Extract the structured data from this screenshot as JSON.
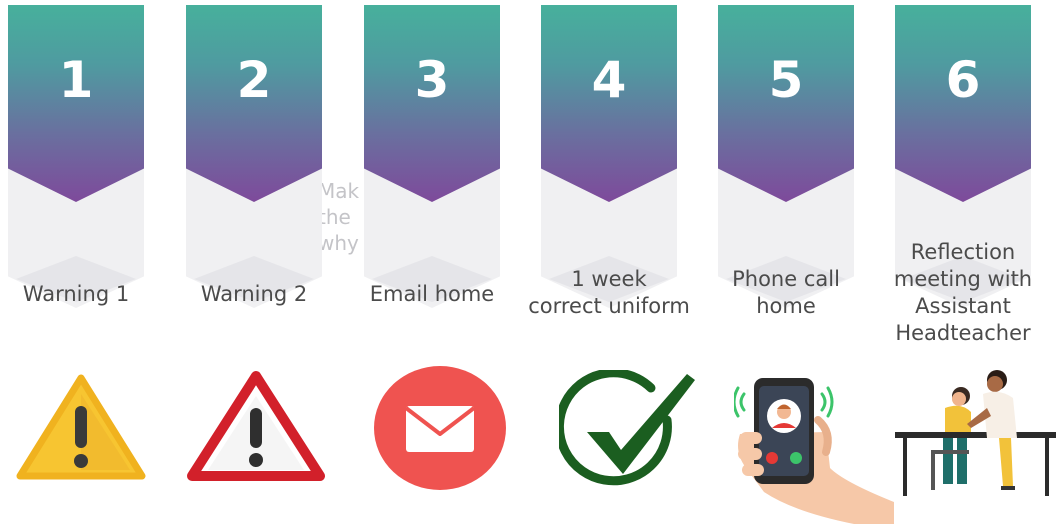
{
  "steps": [
    {
      "number": "1",
      "label_lines": [
        "Warning 1"
      ],
      "icon": "warning-triangle-yellow-icon",
      "color": "#f7c531"
    },
    {
      "number": "2",
      "label_lines": [
        "Warning 2"
      ],
      "icon": "warning-triangle-red-icon",
      "color": "#d2202a"
    },
    {
      "number": "3",
      "label_lines": [
        "Email home"
      ],
      "icon": "envelope-icon",
      "color": "#ef5350"
    },
    {
      "number": "4",
      "label_lines": [
        "1 week",
        "correct uniform"
      ],
      "icon": "checkmark-icon",
      "color": "#1b5e20"
    },
    {
      "number": "5",
      "label_lines": [
        "Phone call",
        "home"
      ],
      "icon": "phone-call-icon",
      "color": "#2b2b2b"
    },
    {
      "number": "6",
      "label_lines": [
        "Reflection",
        "meeting with",
        "Assistant",
        "Headteacher"
      ],
      "icon": "meeting-icon",
      "color": "#f2c23a"
    }
  ],
  "faded_text": [
    "Mak",
    "the",
    "why"
  ],
  "colors": {
    "banner_top": "#47b09c",
    "banner_bottom": "#7e4a9b",
    "label": "#4b4b4b"
  }
}
